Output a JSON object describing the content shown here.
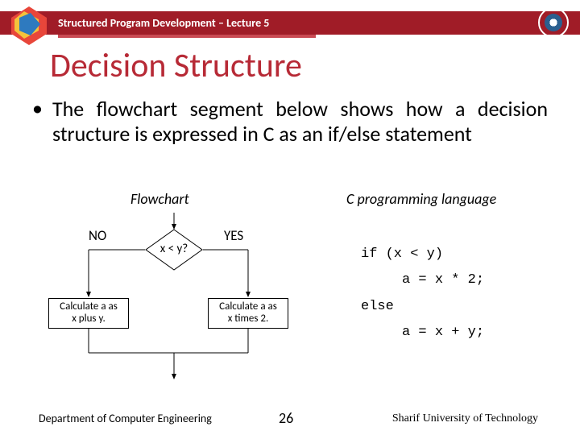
{
  "header": {
    "title": "Structured Program Development – Lecture 5"
  },
  "slide": {
    "title": "Decision Structure",
    "bullet": "The flowchart segment below shows how a decision structure is expressed in C as an if/else statement",
    "flowchart_label": "Flowchart",
    "code_label": "C  programming language"
  },
  "flow": {
    "no": "NO",
    "yes": "YES",
    "condition": "x < y?",
    "left_box_l1": "Calculate a as",
    "left_box_l2": "x plus y.",
    "right_box_l1": "Calculate a as",
    "right_box_l2": "x times 2."
  },
  "code": {
    "l1": "if (x < y)",
    "l2": "     a = x * 2;",
    "l3": "else",
    "l4": "     a = x + y;"
  },
  "footer": {
    "left": "Department of Computer Engineering",
    "num": "26",
    "right": "Sharif University of Technology"
  }
}
